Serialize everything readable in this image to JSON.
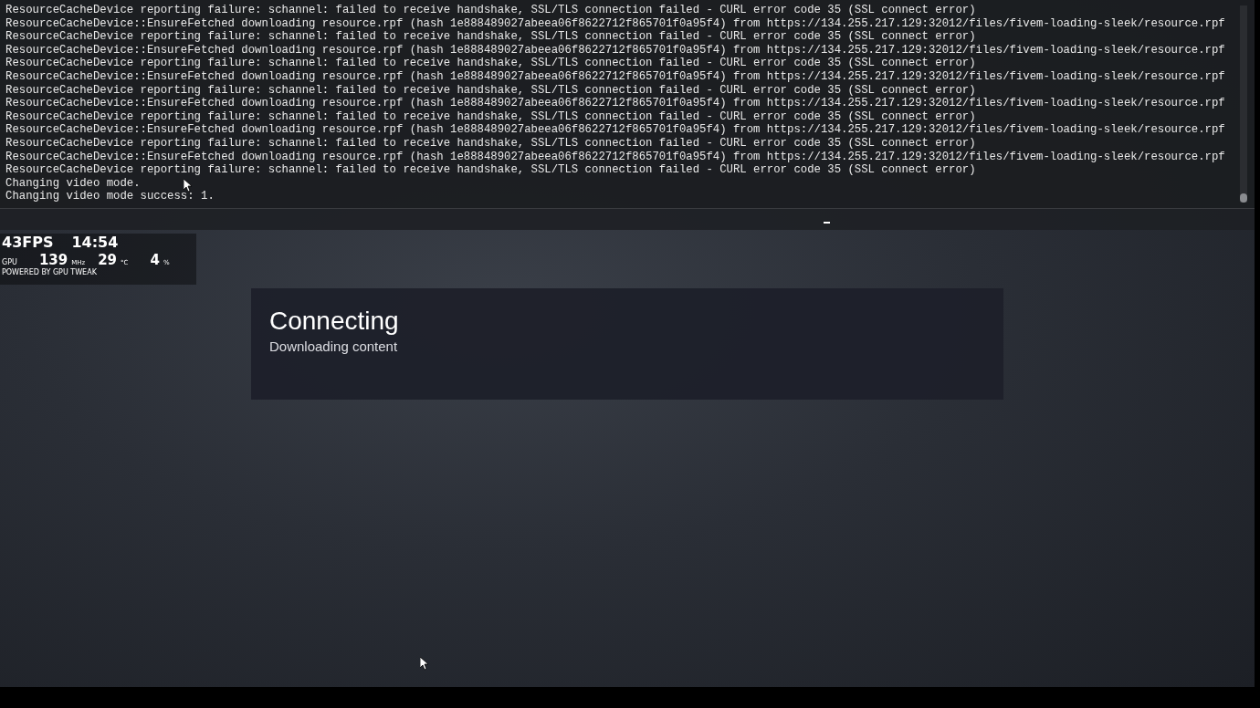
{
  "overlay": {
    "fps": "43FPS",
    "time": "14:54",
    "gpu_label": "GPU",
    "clock": "139",
    "clock_unit": "MHz",
    "temp": "29",
    "temp_unit": "°C",
    "load": "4",
    "load_unit": "%",
    "credit": "POWERED BY GPU TWEAK"
  },
  "console": {
    "lines": [
      "ResourceCacheDevice reporting failure: schannel: failed to receive handshake, SSL/TLS connection failed - CURL error code 35 (SSL connect error)",
      "ResourceCacheDevice::EnsureFetched downloading resource.rpf (hash 1e888489027abeea06f8622712f865701f0a95f4) from https://134.255.217.129:32012/files/fivem-loading-sleek/resource.rpf",
      "ResourceCacheDevice reporting failure: schannel: failed to receive handshake, SSL/TLS connection failed - CURL error code 35 (SSL connect error)",
      "ResourceCacheDevice::EnsureFetched downloading resource.rpf (hash 1e888489027abeea06f8622712f865701f0a95f4) from https://134.255.217.129:32012/files/fivem-loading-sleek/resource.rpf",
      "ResourceCacheDevice reporting failure: schannel: failed to receive handshake, SSL/TLS connection failed - CURL error code 35 (SSL connect error)",
      "ResourceCacheDevice::EnsureFetched downloading resource.rpf (hash 1e888489027abeea06f8622712f865701f0a95f4) from https://134.255.217.129:32012/files/fivem-loading-sleek/resource.rpf",
      "ResourceCacheDevice reporting failure: schannel: failed to receive handshake, SSL/TLS connection failed - CURL error code 35 (SSL connect error)",
      "ResourceCacheDevice::EnsureFetched downloading resource.rpf (hash 1e888489027abeea06f8622712f865701f0a95f4) from https://134.255.217.129:32012/files/fivem-loading-sleek/resource.rpf",
      "ResourceCacheDevice reporting failure: schannel: failed to receive handshake, SSL/TLS connection failed - CURL error code 35 (SSL connect error)",
      "ResourceCacheDevice::EnsureFetched downloading resource.rpf (hash 1e888489027abeea06f8622712f865701f0a95f4) from https://134.255.217.129:32012/files/fivem-loading-sleek/resource.rpf",
      "ResourceCacheDevice reporting failure: schannel: failed to receive handshake, SSL/TLS connection failed - CURL error code 35 (SSL connect error)",
      "ResourceCacheDevice::EnsureFetched downloading resource.rpf (hash 1e888489027abeea06f8622712f865701f0a95f4) from https://134.255.217.129:32012/files/fivem-loading-sleek/resource.rpf",
      "ResourceCacheDevice reporting failure: schannel: failed to receive handshake, SSL/TLS connection failed - CURL error code 35 (SSL connect error)",
      "Changing video mode.",
      "Changing video mode success: 1."
    ]
  },
  "loading_card": {
    "title": "Connecting",
    "status": "Downloading content"
  }
}
